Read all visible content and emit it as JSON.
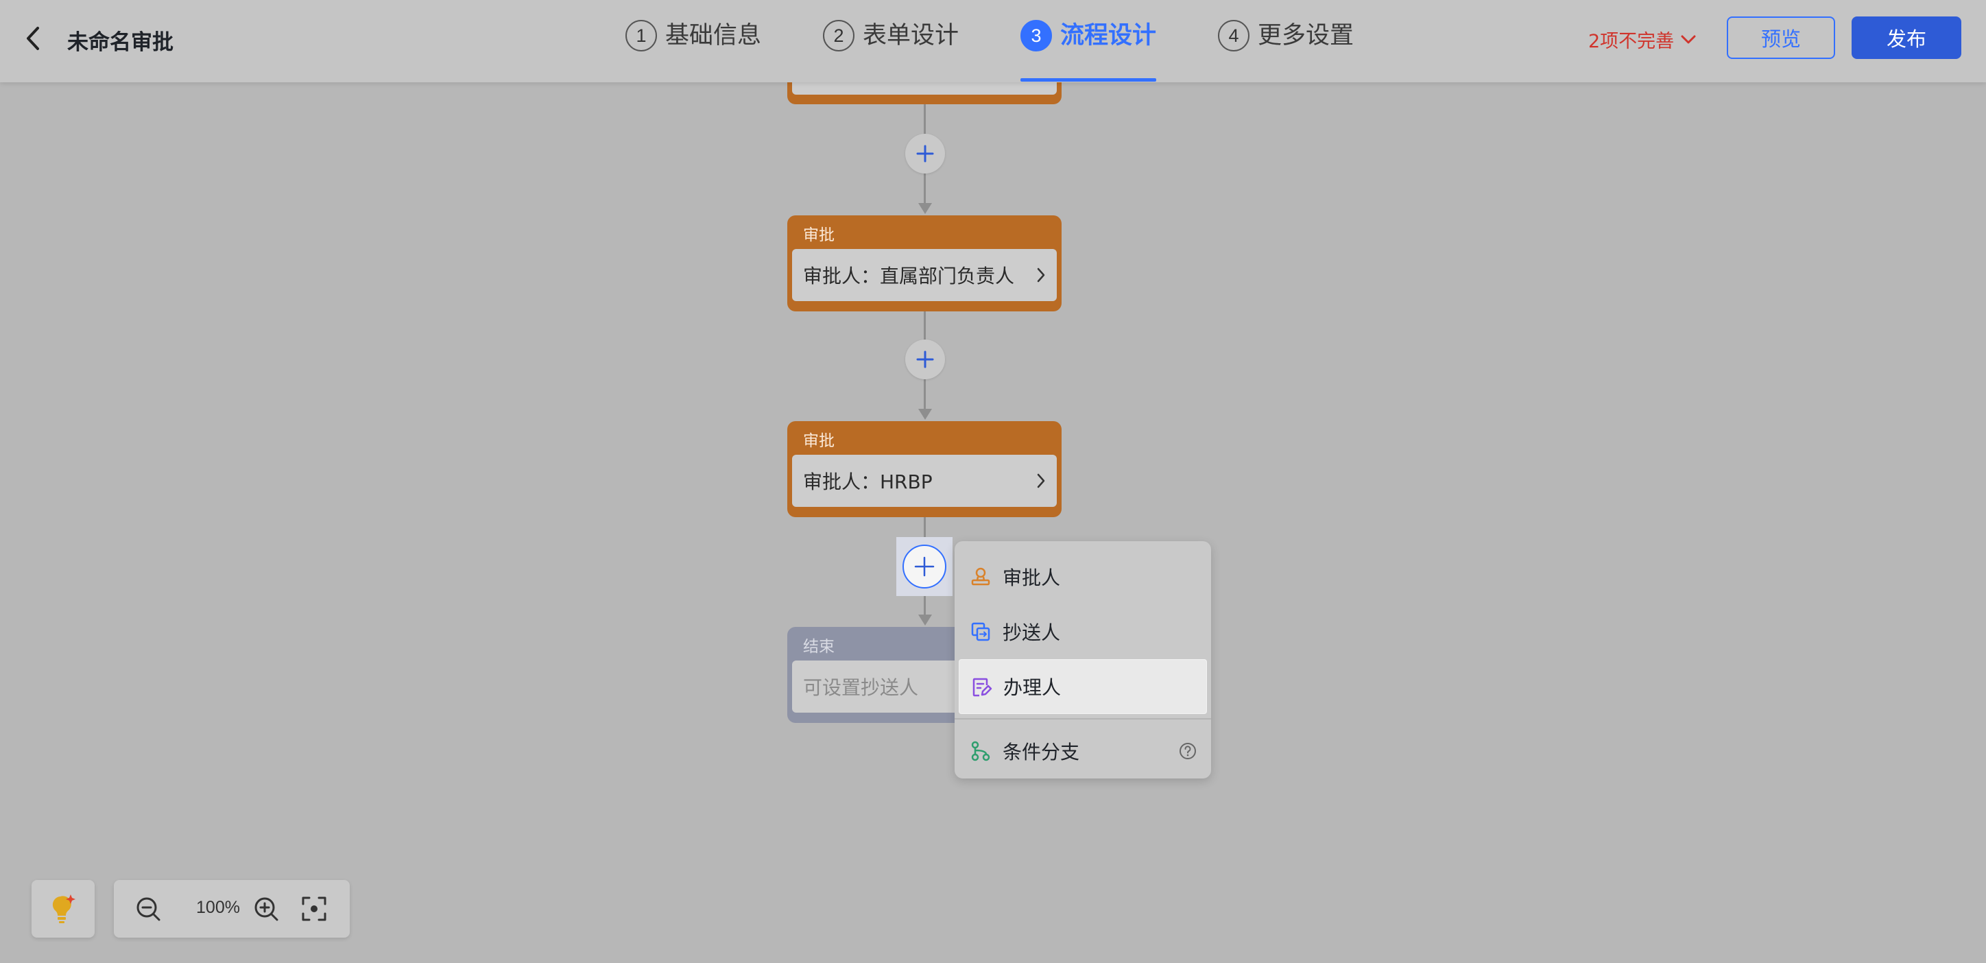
{
  "header": {
    "title": "未命名审批",
    "steps": [
      {
        "num": "1",
        "label": "基础信息"
      },
      {
        "num": "2",
        "label": "表单设计"
      },
      {
        "num": "3",
        "label": "流程设计"
      },
      {
        "num": "4",
        "label": "更多设置"
      }
    ],
    "active_step": 3,
    "warning": "2项不完善",
    "preview_label": "预览",
    "publish_label": "发布"
  },
  "flow": {
    "nodes": [
      {
        "type": "审批",
        "content": "审批人：直属部门负责人"
      },
      {
        "type": "审批",
        "content": "审批人：HRBP"
      },
      {
        "type": "结束",
        "content": "可设置抄送人"
      }
    ]
  },
  "add_menu": {
    "items": [
      {
        "label": "审批人",
        "icon": "approver-stamp-icon"
      },
      {
        "label": "抄送人",
        "icon": "cc-copy-icon"
      },
      {
        "label": "办理人",
        "icon": "handler-edit-icon"
      },
      {
        "label": "条件分支",
        "icon": "condition-branch-icon"
      }
    ],
    "selected": "办理人"
  },
  "zoom": {
    "level": "100%"
  },
  "colors": {
    "accent": "#3370ff",
    "approval_node": "#b96b24",
    "end_node": "#8e93a6",
    "warning": "#d0342c"
  }
}
